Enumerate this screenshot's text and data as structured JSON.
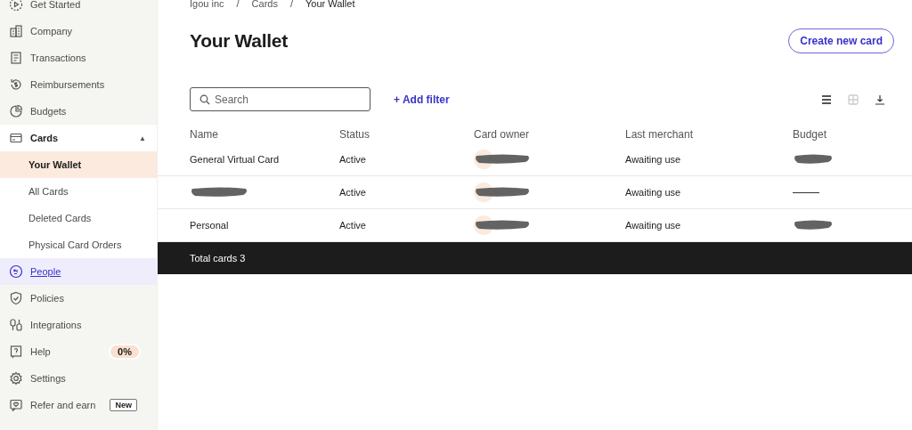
{
  "sidebar": {
    "items": [
      {
        "label": "Get Started",
        "selected": false
      },
      {
        "label": "Company",
        "selected": false
      },
      {
        "label": "Transactions",
        "selected": false
      },
      {
        "label": "Reimbursements",
        "selected": false
      },
      {
        "label": "Budgets",
        "selected": false
      },
      {
        "label": "Cards",
        "selected": false,
        "expanded": true,
        "toggle": "▲",
        "children": [
          {
            "label": "Your Wallet",
            "selected": true
          },
          {
            "label": "All Cards",
            "selected": false
          },
          {
            "label": "Deleted Cards",
            "selected": false
          },
          {
            "label": "Physical Card Orders",
            "selected": false
          }
        ]
      },
      {
        "label": "People",
        "selected": false,
        "hovered": true
      },
      {
        "label": "Policies",
        "selected": false
      },
      {
        "label": "Integrations",
        "selected": false
      },
      {
        "label": "Help",
        "selected": false,
        "progress": "0%"
      },
      {
        "label": "Settings",
        "selected": false
      },
      {
        "label": "Refer and earn",
        "selected": false,
        "tag": "New"
      }
    ]
  },
  "breadcrumb": [
    {
      "label": "Igou inc",
      "separator": "/"
    },
    {
      "label": "Cards",
      "separator": "/"
    },
    {
      "label": "Your Wallet"
    }
  ],
  "page_title": "Your Wallet",
  "create_button": "Create new card",
  "search": {
    "placeholder": "Search"
  },
  "add_filter": "+ Add filter",
  "view_toggle": [
    {
      "selected": true
    },
    {
      "selected": false
    }
  ],
  "table": {
    "columns": [
      "Name",
      "Status",
      "Card owner",
      "Last merchant",
      "Budget"
    ],
    "rows": [
      {
        "cells": [
          {
            "kind": "text",
            "text": "General Virtual Card"
          },
          {
            "kind": "text",
            "text": "Active"
          },
          {
            "kind": "redacted"
          },
          {
            "kind": "text",
            "text": "Awaiting use"
          },
          {
            "kind": "redacted"
          }
        ]
      },
      {
        "cells": [
          {
            "kind": "redacted"
          },
          {
            "kind": "text",
            "text": "Active"
          },
          {
            "kind": "redacted"
          },
          {
            "kind": "text",
            "text": "Awaiting use"
          },
          {
            "kind": "dash"
          }
        ]
      },
      {
        "cells": [
          {
            "kind": "text",
            "text": "Personal"
          },
          {
            "kind": "text",
            "text": "Active"
          },
          {
            "kind": "redacted"
          },
          {
            "kind": "text",
            "text": "Awaiting use"
          },
          {
            "kind": "redacted"
          }
        ]
      }
    ],
    "footer": "Total cards 3"
  }
}
